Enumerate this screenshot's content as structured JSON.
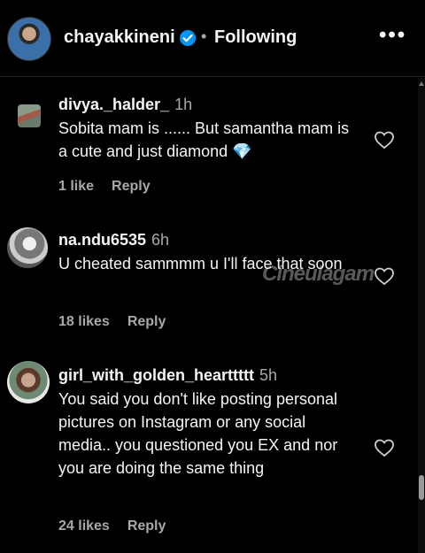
{
  "header": {
    "username": "chayakkineni",
    "separator": "•",
    "follow_state": "Following",
    "more_glyph": "•••"
  },
  "comments": [
    {
      "username": "divya._halder_",
      "time": "1h",
      "text": "Sobita mam is ...... But samantha mam is a cute and just diamond 💎",
      "likes": "1 like",
      "reply": "Reply"
    },
    {
      "username": "na.ndu6535",
      "time": "6h",
      "text": "U cheated sammmm u I'll face that soon",
      "likes": "18 likes",
      "reply": "Reply"
    },
    {
      "username": "girl_with_golden_hearttttt",
      "time": "5h",
      "text": "You said you don't like posting personal pictures on Instagram or any social media.. you questioned you EX and nor you are doing the same thing",
      "likes": "24 likes",
      "reply": "Reply"
    }
  ],
  "watermark": "Cineulagam",
  "colors": {
    "background": "#000000",
    "muted": "#a8a8a8",
    "verified": "#0095f6"
  }
}
